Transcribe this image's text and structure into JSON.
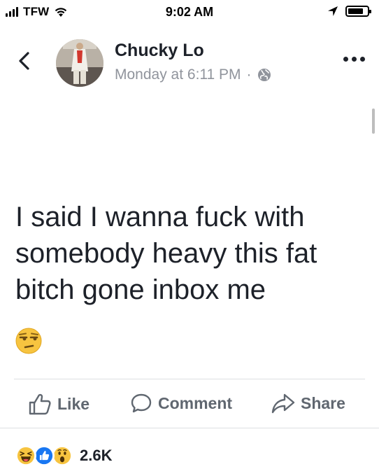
{
  "status_bar": {
    "carrier": "TFW",
    "time": "9:02 AM"
  },
  "post": {
    "author": "Chucky Lo",
    "timestamp": "Monday at 6:11 PM",
    "separator": "·",
    "privacy_icon": "globe-icon",
    "text": "I said I wanna fuck with somebody heavy this fat bitch gone inbox me",
    "emoji": "unamused-face"
  },
  "actions": {
    "like": "Like",
    "comment": "Comment",
    "share": "Share"
  },
  "reactions": {
    "types": [
      "haha",
      "like",
      "wow"
    ],
    "count": "2.6K"
  },
  "colors": {
    "text": "#1d2129",
    "secondary": "#90949c",
    "action": "#606770",
    "like_blue": "#1877f2",
    "emoji_yellow": "#f7c440"
  }
}
